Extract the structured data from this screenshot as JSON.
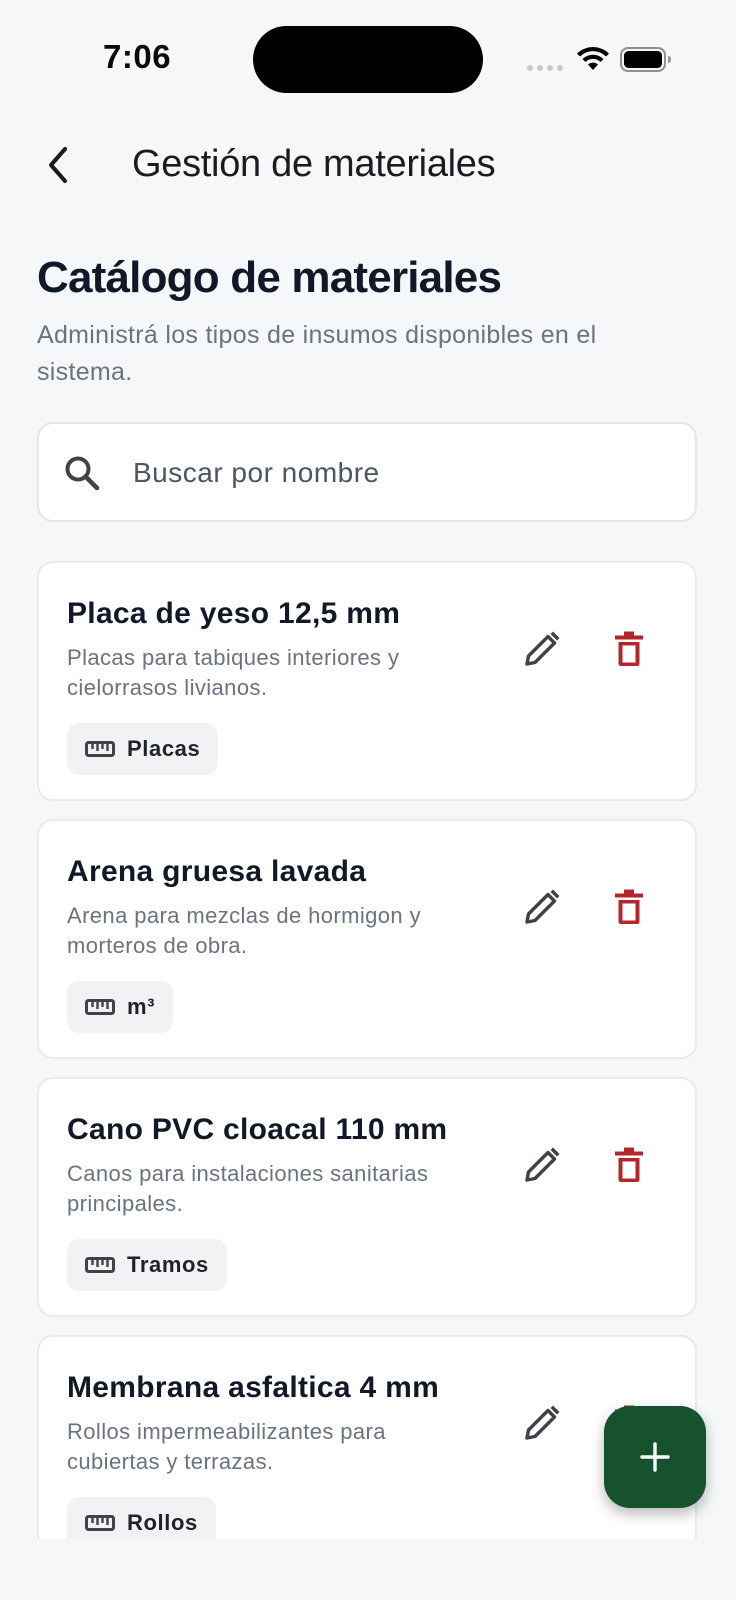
{
  "status_bar": {
    "time": "7:06"
  },
  "app_bar": {
    "title": "Gestión de materiales"
  },
  "header": {
    "title": "Catálogo de materiales",
    "subtitle": "Administrá los tipos de insumos disponibles en el sistema."
  },
  "search": {
    "placeholder": "Buscar por nombre",
    "value": ""
  },
  "materials": [
    {
      "name": "Placa de yeso 12,5 mm",
      "description": "Placas para tabiques interiores y cielorrasos livianos.",
      "unit": "Placas"
    },
    {
      "name": "Arena gruesa lavada",
      "description": "Arena para mezclas de hormigon y morteros de obra.",
      "unit": "m³"
    },
    {
      "name": "Cano PVC cloacal 110 mm",
      "description": "Canos para instalaciones sanitarias principales.",
      "unit": "Tramos"
    },
    {
      "name": "Membrana asfaltica 4 mm",
      "description": "Rollos impermeabilizantes para cubiertas y terrazas.",
      "unit": "Rollos"
    }
  ],
  "colors": {
    "background": "#f6f7f9",
    "edit_icon": "#3f4248",
    "delete_icon": "#b3262c",
    "fab": "#17522f"
  },
  "icons": {
    "back": "chevron-left-icon",
    "search": "search-icon",
    "edit": "pencil-icon",
    "delete": "trash-icon",
    "unit": "ruler-icon",
    "fab": "plus-icon"
  }
}
